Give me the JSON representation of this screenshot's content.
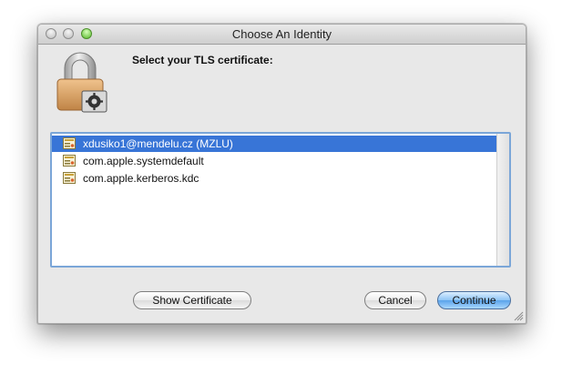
{
  "window": {
    "title": "Choose An Identity"
  },
  "dialog": {
    "prompt": "Select your TLS certificate:",
    "icon": "lock-certificate-icon"
  },
  "identities": [
    {
      "label": "xdusiko1@mendelu.cz  (MZLU)",
      "selected": true
    },
    {
      "label": "com.apple.systemdefault",
      "selected": false
    },
    {
      "label": "com.apple.kerberos.kdc",
      "selected": false
    }
  ],
  "buttons": {
    "show_certificate": "Show Certificate",
    "cancel": "Cancel",
    "continue": "Continue"
  },
  "colors": {
    "selection": "#3875d7",
    "default_button": "#5aa3ea",
    "focus_ring": "#7ba6d8"
  }
}
